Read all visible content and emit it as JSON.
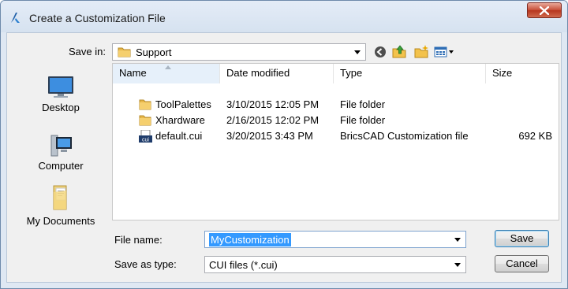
{
  "window": {
    "title": "Create a Customization File"
  },
  "toolbar": {
    "save_in_label": "Save in:",
    "save_in_value": "Support",
    "icons": [
      "back-icon",
      "up-folder-icon",
      "new-folder-icon",
      "views-menu-icon"
    ]
  },
  "places": [
    {
      "label": "Desktop",
      "icon": "desktop-icon"
    },
    {
      "label": "Computer",
      "icon": "computer-icon"
    },
    {
      "label": "My Documents",
      "icon": "documents-icon"
    }
  ],
  "list": {
    "columns": [
      "Name",
      "Date modified",
      "Type",
      "Size"
    ],
    "rows": [
      {
        "name": "ToolPalettes",
        "date": "3/10/2015 12:05 PM",
        "type": "File folder",
        "size": "",
        "icon": "folder-icon"
      },
      {
        "name": "Xhardware",
        "date": "2/16/2015 12:02 PM",
        "type": "File folder",
        "size": "",
        "icon": "folder-icon"
      },
      {
        "name": "default.cui",
        "date": "3/20/2015 3:43 PM",
        "type": "BricsCAD Customization file",
        "size": "692 KB",
        "icon": "cui-file-icon"
      }
    ]
  },
  "form": {
    "file_name_label": "File name:",
    "file_name_value": "MyCustomization",
    "save_as_type_label": "Save as type:",
    "save_as_type_value": "CUI files (*.cui)"
  },
  "buttons": {
    "save": "Save",
    "cancel": "Cancel"
  }
}
